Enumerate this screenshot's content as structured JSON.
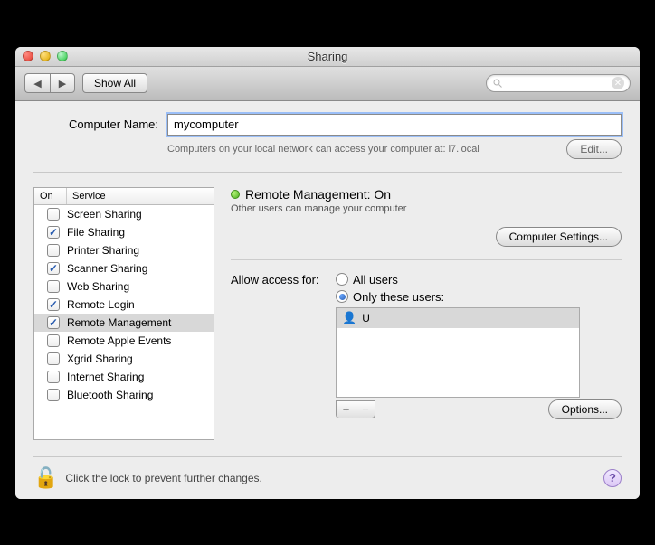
{
  "window": {
    "title": "Sharing"
  },
  "toolbar": {
    "show_all": "Show All"
  },
  "computer_name": {
    "label": "Computer Name:",
    "value": "mycomputer",
    "subtext": "Computers on your local network can access your computer at: i7.local",
    "edit": "Edit..."
  },
  "services": {
    "col_on": "On",
    "col_service": "Service",
    "items": [
      {
        "on": false,
        "label": "Screen Sharing",
        "selected": false
      },
      {
        "on": true,
        "label": "File Sharing",
        "selected": false
      },
      {
        "on": false,
        "label": "Printer Sharing",
        "selected": false
      },
      {
        "on": true,
        "label": "Scanner Sharing",
        "selected": false
      },
      {
        "on": false,
        "label": "Web Sharing",
        "selected": false
      },
      {
        "on": true,
        "label": "Remote Login",
        "selected": false
      },
      {
        "on": true,
        "label": "Remote Management",
        "selected": true
      },
      {
        "on": false,
        "label": "Remote Apple Events",
        "selected": false
      },
      {
        "on": false,
        "label": "Xgrid Sharing",
        "selected": false
      },
      {
        "on": false,
        "label": "Internet Sharing",
        "selected": false
      },
      {
        "on": false,
        "label": "Bluetooth Sharing",
        "selected": false
      }
    ]
  },
  "detail": {
    "status_title": "Remote Management: On",
    "status_sub": "Other users can manage your computer",
    "computer_settings": "Computer Settings...",
    "allow_label": "Allow access for:",
    "all_users": "All users",
    "only_users": "Only these users:",
    "users": [
      {
        "name": "U"
      }
    ],
    "options": "Options..."
  },
  "footer": {
    "lock_text": "Click the lock to prevent further changes."
  }
}
